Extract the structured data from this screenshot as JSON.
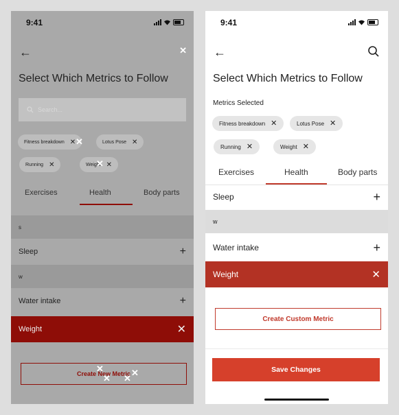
{
  "status": {
    "time": "9:41"
  },
  "left_screen": {
    "title": "Select Which Metrics to Follow",
    "search_placeholder": "Search...",
    "chips": [
      {
        "label": "Fitness breakdown"
      },
      {
        "label": "Lotus Pose"
      },
      {
        "label": "Running"
      },
      {
        "label": "Weight"
      }
    ],
    "tabs": [
      "Exercises",
      "Health",
      "Body parts"
    ],
    "active_tab": "Health",
    "rows": [
      {
        "label": "s",
        "type": "section"
      },
      {
        "label": "Sleep",
        "type": "item",
        "action": "+"
      },
      {
        "label": "w",
        "type": "section"
      },
      {
        "label": "Water intake",
        "type": "item",
        "action": "+"
      },
      {
        "label": "Weight",
        "type": "selected",
        "action": "✕"
      }
    ],
    "create_button": "Create New Metric"
  },
  "right_screen": {
    "title": "Select Which Metrics to Follow",
    "selected_label": "Metrics Selected",
    "chips": [
      {
        "label": "Fitness breakdown"
      },
      {
        "label": "Lotus Pose"
      },
      {
        "label": "Running"
      },
      {
        "label": "Weight"
      }
    ],
    "tabs": [
      "Exercises",
      "Health",
      "Body parts"
    ],
    "active_tab": "Health",
    "rows": [
      {
        "label": "Sleep",
        "type": "item",
        "action": "+"
      },
      {
        "label": "w",
        "type": "section"
      },
      {
        "label": "Water intake",
        "type": "item",
        "action": "+"
      },
      {
        "label": "Weight",
        "type": "selected",
        "action": "✕"
      }
    ],
    "create_button": "Create Custom Metric",
    "save_button": "Save Changes"
  },
  "colors": {
    "accent": "#c0392b",
    "selected_row": "#b33224",
    "save_button": "#d6402b",
    "left_selected_row": "#8e0d07",
    "chip_bg": "#e6e6e6"
  },
  "icons": {
    "back": "arrow-left-icon",
    "search": "search-icon",
    "add": "plus-icon",
    "remove": "close-icon"
  }
}
